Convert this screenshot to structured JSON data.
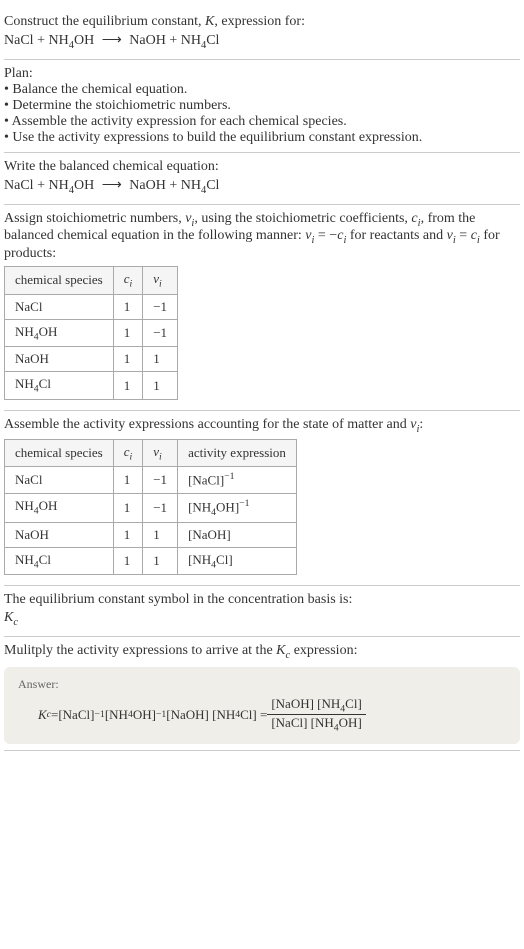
{
  "header": {
    "prompt": "Construct the equilibrium constant, ",
    "kvar": "K",
    "prompt2": ", expression for:",
    "equation_lhs1": "NaCl",
    "plus": " + ",
    "equation_lhs2": "NH",
    "sub4": "4",
    "oh": "OH",
    "arrow": "⟶",
    "equation_rhs1": "NaOH",
    "equation_rhs2": "NH",
    "cl": "Cl"
  },
  "plan": {
    "title": "Plan:",
    "items": [
      "Balance the chemical equation.",
      "Determine the stoichiometric numbers.",
      "Assemble the activity expression for each chemical species.",
      "Use the activity expressions to build the equilibrium constant expression."
    ]
  },
  "balanced": {
    "title": "Write the balanced chemical equation:"
  },
  "stoich": {
    "text1": "Assign stoichiometric numbers, ",
    "nu": "ν",
    "sub_i": "i",
    "text2": ", using the stoichiometric coefficients, ",
    "c": "c",
    "text3": ", from the balanced chemical equation in the following manner: ",
    "eq1a": "ν",
    "eq1b": " = −",
    "eq1c": "c",
    "text4": " for reactants and ",
    "eq2": " = ",
    "text5": " for products:",
    "table": {
      "headers": [
        "chemical species",
        "c",
        "ν"
      ],
      "rows": [
        {
          "species": "NaCl",
          "c": "1",
          "nu": "−1"
        },
        {
          "species": "NH4OH",
          "c": "1",
          "nu": "−1"
        },
        {
          "species": "NaOH",
          "c": "1",
          "nu": "1"
        },
        {
          "species": "NH4Cl",
          "c": "1",
          "nu": "1"
        }
      ]
    }
  },
  "activity": {
    "title1": "Assemble the activity expressions accounting for the state of matter and ",
    "title2": ":",
    "table": {
      "headers": [
        "chemical species",
        "c",
        "ν",
        "activity expression"
      ],
      "rows": [
        {
          "species": "NaCl",
          "c": "1",
          "nu": "−1",
          "expr": "[NaCl]",
          "exp": "−1"
        },
        {
          "species": "NH4OH",
          "c": "1",
          "nu": "−1",
          "expr": "[NH4OH]",
          "exp": "−1"
        },
        {
          "species": "NaOH",
          "c": "1",
          "nu": "1",
          "expr": "[NaOH]",
          "exp": ""
        },
        {
          "species": "NH4Cl",
          "c": "1",
          "nu": "1",
          "expr": "[NH4Cl]",
          "exp": ""
        }
      ]
    }
  },
  "symbol": {
    "text": "The equilibrium constant symbol in the concentration basis is:",
    "kc": "K",
    "sub_c": "c"
  },
  "multiply": {
    "text1": "Mulitply the activity expressions to arrive at the ",
    "text2": " expression:"
  },
  "answer": {
    "label": "Answer:",
    "kc": "K",
    "sub_c": "c",
    "eq": " = ",
    "term1": "[NaCl]",
    "exp1": "−1",
    "term2": " [NH",
    "term2b": "OH]",
    "exp2": "−1",
    "term3": " [NaOH] [NH",
    "term3b": "Cl] = ",
    "num": "[NaOH] [NH4Cl]",
    "den": "[NaCl] [NH4OH]"
  },
  "chart_data": {
    "type": "table",
    "tables": [
      {
        "title": "Stoichiometric numbers",
        "headers": [
          "chemical species",
          "c_i",
          "nu_i"
        ],
        "rows": [
          [
            "NaCl",
            1,
            -1
          ],
          [
            "NH4OH",
            1,
            -1
          ],
          [
            "NaOH",
            1,
            1
          ],
          [
            "NH4Cl",
            1,
            1
          ]
        ]
      },
      {
        "title": "Activity expressions",
        "headers": [
          "chemical species",
          "c_i",
          "nu_i",
          "activity expression"
        ],
        "rows": [
          [
            "NaCl",
            1,
            -1,
            "[NaCl]^-1"
          ],
          [
            "NH4OH",
            1,
            -1,
            "[NH4OH]^-1"
          ],
          [
            "NaOH",
            1,
            1,
            "[NaOH]"
          ],
          [
            "NH4Cl",
            1,
            1,
            "[NH4Cl]"
          ]
        ]
      }
    ],
    "equilibrium_constant": "Kc = [NaOH][NH4Cl] / ([NaCl][NH4OH])"
  }
}
